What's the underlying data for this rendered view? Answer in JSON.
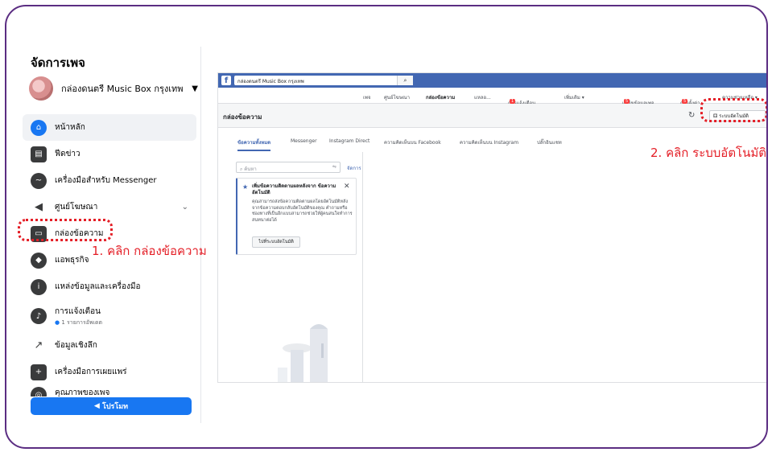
{
  "sidebar": {
    "title": "จัดการเพจ",
    "page_name": "กล่องดนตรี Music Box กรุงเทพ",
    "items": [
      {
        "label": "หน้าหลัก",
        "icon": "home-icon"
      },
      {
        "label": "ฟีดข่าว",
        "icon": "news-feed-icon"
      },
      {
        "label": "เครื่องมือสำหรับ Messenger",
        "icon": "messenger-icon"
      },
      {
        "label": "ศูนย์โฆษณา",
        "icon": "megaphone-icon"
      },
      {
        "label": "กล่องข้อความ",
        "icon": "inbox-icon"
      },
      {
        "label": "แอพธุรกิจ",
        "icon": "cube-icon"
      },
      {
        "label": "แหล่งข้อมูลและเครื่องมือ",
        "icon": "info-icon"
      },
      {
        "label": "การแจ้งเตือน",
        "sub": "1 รายการอัพเดต",
        "icon": "bell-icon"
      },
      {
        "label": "ข้อมูลเชิงลึก",
        "icon": "insights-icon"
      },
      {
        "label": "เครื่องมือการเผยแพร่",
        "icon": "publishing-icon"
      },
      {
        "label": "คุณภาพของเพจ",
        "icon": "page-quality-icon"
      }
    ],
    "promote_label": "โปรโมท"
  },
  "annotations": {
    "step1": "1. คลิก กล่องข้อความ",
    "step2": "2. คลิก ระบบอัตโนมัติ"
  },
  "screenshot": {
    "search_text": "กล่องดนตรี Music Box กรุงเทพ",
    "nav": [
      "เพจ",
      "ศูนย์โฆษณา",
      "กล่องข้อความ",
      "แหลอ...",
      "การแจ้งเตือน",
      "เพิ่มเติม ▾",
      "แก้ไขข้อมูลเพจ",
      "การตั้งค่า",
      "ความช่วยเหลือ ▾"
    ],
    "badges": {
      "notifications": "1",
      "edit": "5",
      "settings": "5"
    },
    "inbox_title": "กล่องข้อความ",
    "automation_label": "ระบบอัตโนมัติ",
    "tabs": [
      "ข้อความทั้งหมด",
      "Messenger",
      "Instagram Direct",
      "ความคิดเห็นบน Facebook",
      "ความคิดเห็นบน Instagram",
      "ปลั๊กอินแชท"
    ],
    "search_placeholder": "ค้นหา",
    "manage_label": "จัดการ",
    "card": {
      "title": "เพิ่มข้อความติดตามผลหลังจาก ข้อความอัตโนมัติ",
      "body": "คุณสามารถส่งข้อความติดตามผลโดยอัตโนมัติหลังจากข้อความตอบกลับอัตโนมัติของคุณ คำถามหรือช่องทางที่เป็นอีกแบบสามารถช่วยให้ผู้คนสนใจทำการสนทนาต่อได้",
      "button": "ไปที่ระบบอัตโนมัติ"
    }
  }
}
